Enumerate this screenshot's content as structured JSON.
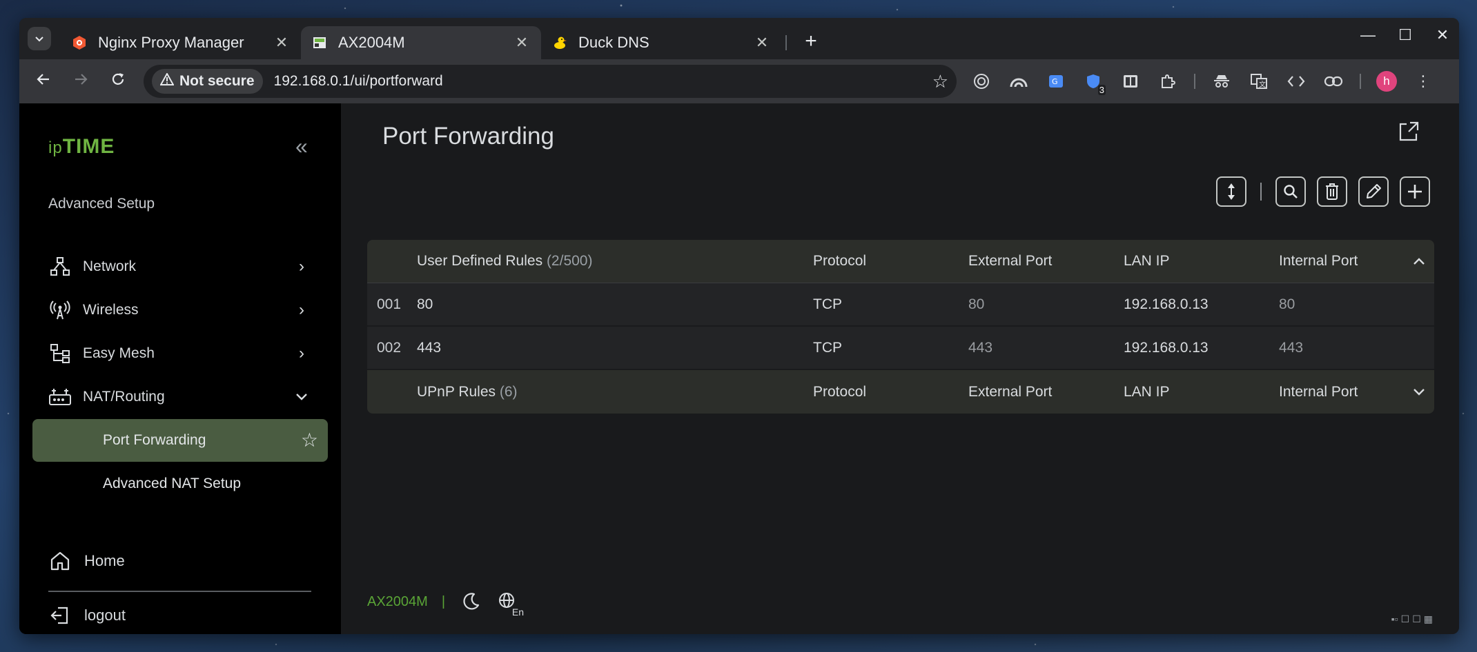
{
  "browser": {
    "tabs": [
      {
        "title": "Nginx Proxy Manager",
        "active": false,
        "icon": "nginx-hex-icon"
      },
      {
        "title": "AX2004M",
        "active": true,
        "icon": "iptime-icon"
      },
      {
        "title": "Duck DNS",
        "active": false,
        "icon": "duck-icon"
      }
    ],
    "security_label": "Not secure",
    "url": "192.168.0.1/ui/portforward",
    "profile_initial": "h",
    "extension_badge": "3"
  },
  "sidebar": {
    "logo_prefix": "ip",
    "logo_main": "TIME",
    "section_title": "Advanced Setup",
    "items": [
      {
        "label": "Network",
        "icon": "network-icon",
        "expanded": false
      },
      {
        "label": "Wireless",
        "icon": "wireless-icon",
        "expanded": false
      },
      {
        "label": "Easy Mesh",
        "icon": "mesh-icon",
        "expanded": false
      },
      {
        "label": "NAT/Routing",
        "icon": "router-icon",
        "expanded": true
      }
    ],
    "sub_items": [
      {
        "label": "Port Forwarding",
        "active": true
      },
      {
        "label": "Advanced NAT Setup",
        "active": false
      }
    ],
    "home_label": "Home",
    "logout_label": "logout"
  },
  "main": {
    "title": "Port Forwarding",
    "user_rules": {
      "title": "User Defined Rules",
      "count": "(2/500)",
      "columns": {
        "protocol": "Protocol",
        "external": "External Port",
        "lan_ip": "LAN IP",
        "internal": "Internal Port"
      },
      "rows": [
        {
          "num": "001",
          "name": "80",
          "protocol": "TCP",
          "external": "80",
          "lan_ip": "192.168.0.13",
          "internal": "80"
        },
        {
          "num": "002",
          "name": "443",
          "protocol": "TCP",
          "external": "443",
          "lan_ip": "192.168.0.13",
          "internal": "443"
        }
      ]
    },
    "upnp_rules": {
      "title": "UPnP Rules",
      "count": "(6)",
      "columns": {
        "protocol": "Protocol",
        "external": "External Port",
        "lan_ip": "LAN IP",
        "internal": "Internal Port"
      }
    }
  },
  "footer": {
    "model": "AX2004M",
    "separator": "|",
    "lang_badge": "En"
  },
  "colors": {
    "accent_green": "#6fb442",
    "active_menu_bg": "#4a5c41"
  }
}
